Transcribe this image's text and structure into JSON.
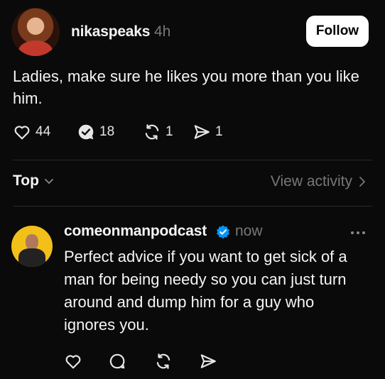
{
  "post": {
    "author": "nikaspeaks",
    "time": "4h",
    "follow_label": "Follow",
    "text": "Ladies, make sure he likes you more than you like him.",
    "likes": "44",
    "replies": "18",
    "reposts": "1",
    "shares": "1"
  },
  "sort": {
    "label": "Top",
    "view_activity": "View activity"
  },
  "reply": {
    "author": "comeonmanpodcast",
    "time": "now",
    "text": "Perfect advice if you want to get sick of a man for being needy so you can just turn around and dump him for a guy who ignores you."
  },
  "colors": {
    "background": "#0a0a0a",
    "text": "#f3f5f7",
    "muted": "#777777",
    "verified": "#0095f6",
    "follow_bg": "#ffffff"
  },
  "icons": {
    "like": "heart-icon",
    "reply": "speech-bubble-icon",
    "repost": "repost-icon",
    "share": "paper-plane-icon",
    "verified": "verified-badge-icon",
    "sort": "chevron-down-icon",
    "view_activity": "chevron-right-icon",
    "more": "more-dots-icon"
  }
}
